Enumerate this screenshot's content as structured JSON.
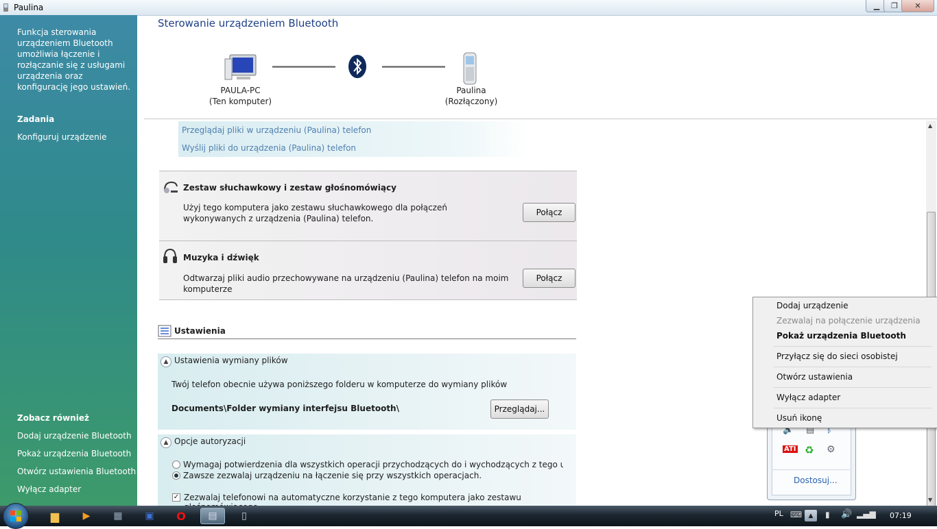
{
  "window": {
    "title": "Paulina"
  },
  "left_pane": {
    "description": "Funkcja sterowania urządzeniem Bluetooth umożliwia łączenie i rozłączanie się z usługami urządzenia oraz konfigurację jego ustawień.",
    "tasks_heading": "Zadania",
    "tasks": [
      "Konfiguruj urządzenie"
    ],
    "see_also_heading": "Zobacz również",
    "see_also": [
      "Dodaj urządzenie Bluetooth",
      "Pokaż urządzenia Bluetooth",
      "Otwórz ustawienia Bluetooth",
      "Wyłącz adapter"
    ]
  },
  "header": {
    "title": "Sterowanie urządzeniem Bluetooth",
    "computer_name": "PAULA-PC",
    "computer_sub": "(Ten komputer)",
    "device_name": "Paulina",
    "device_status": "(Rozłączony)"
  },
  "file_links": [
    "Przeglądaj pliki w urządzeniu (Paulina) telefon",
    "Wyślij pliki do urządzenia (Paulina) telefon"
  ],
  "services": [
    {
      "title": "Zestaw słuchawkowy i zestaw głośnomówiący",
      "description": "Użyj tego komputera jako zestawu słuchawkowego dla połączeń wykonywanych z urządzenia (Paulina) telefon.",
      "button": "Połącz"
    },
    {
      "title": "Muzyka i dźwięk",
      "description": "Odtwarzaj pliki audio przechowywane na urządzeniu (Paulina) telefon na moim komputerze",
      "button": "Połącz"
    }
  ],
  "settings": {
    "heading": "Ustawienia",
    "file_exchange": {
      "title": "Ustawienia wymiany plików",
      "text": "Twój telefon obecnie używa poniższego folderu w komputerze do wymiany plików",
      "folder": "Documents\\Folder wymiany interfejsu Bluetooth\\",
      "browse": "Przeglądaj..."
    },
    "auth": {
      "title": "Opcje autoryzacji",
      "option1": "Wymagaj potwierdzenia dla wszystkich operacji przychodzących do i wychodzących z tego urządzenia Blu",
      "option2": "Zawsze zezwalaj urządzeniu na łączenie się przy wszystkich operacjach.",
      "selected": 2,
      "checkbox": "Zezwalaj telefonowi na automatyczne korzystanie z tego komputera jako zestawu głośnomówiącego.",
      "checked": true
    }
  },
  "context_menu": {
    "items": [
      {
        "label": "Dodaj urządzenie",
        "enabled": true
      },
      {
        "label": "Zezwalaj na połączenie urządzenia",
        "enabled": false
      },
      {
        "label": "Pokaż urządzenia Bluetooth",
        "bold": true
      },
      {
        "label": "Przyłącz się do sieci osobistej",
        "enabled": true
      },
      {
        "label": "Otwórz ustawienia",
        "enabled": true
      },
      {
        "label": "Wyłącz adapter",
        "enabled": true
      },
      {
        "label": "Usuń ikonę",
        "enabled": true
      }
    ]
  },
  "tray_popup": {
    "customize": "Dostosuj..."
  },
  "taskbar": {
    "language": "PL",
    "clock": "07:19"
  },
  "colors": {
    "accent": "#1e3f86",
    "link": "#4f7fb0",
    "left_pane": "#2f8a8a"
  }
}
